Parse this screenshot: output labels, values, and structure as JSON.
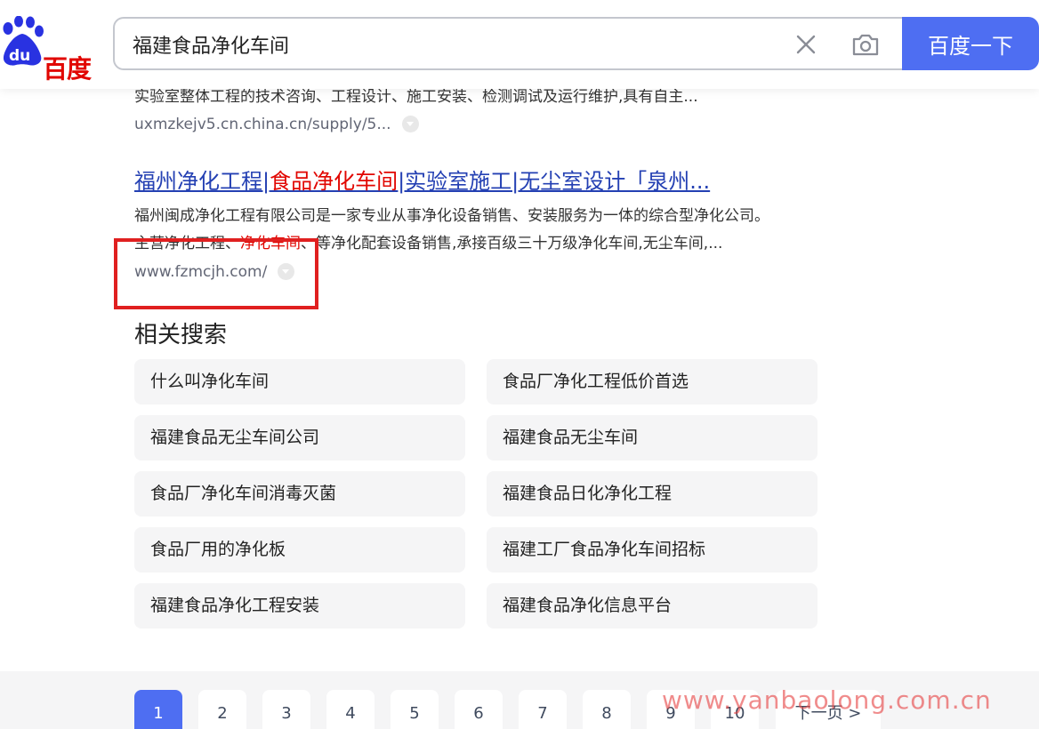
{
  "header": {
    "logo_text": "百度",
    "search_value": "福建食品净化车间",
    "search_button_label": "百度一下"
  },
  "prev_result": {
    "desc_partial": "实验室整体工程的技术咨询、工程设计、施工安装、检测调试及运行维护,具有自主...",
    "url": "uxmzkejv5.cn.china.cn/supply/5..."
  },
  "result": {
    "title_part1": "福州净化工程|",
    "title_highlight": "食品净化车间",
    "title_part2": "|实验室施工|无尘室设计「泉州...",
    "desc_line1": "福州闽成净化工程有限公司是一家专业从事净化设备销售、安装服务为一体的综合型净化公司。",
    "desc_line2_pre": "主营净化工程、",
    "desc_line2_hl": "净化车间",
    "desc_line2_post": "、等净化配套设备销售,承接百级三十万级净化车间,无尘车间,...",
    "url": "www.fzmcjh.com/"
  },
  "related": {
    "title": "相关搜索",
    "items": [
      "什么叫净化车间",
      "食品厂净化工程低价首选",
      "福建食品无尘车间公司",
      "福建食品无尘车间",
      "食品厂净化车间消毒灭菌",
      "福建食品日化净化工程",
      "食品厂用的净化板",
      "福建工厂食品净化车间招标",
      "福建食品净化工程安装",
      "福建食品净化信息平台"
    ]
  },
  "pagination": {
    "pages": [
      "1",
      "2",
      "3",
      "4",
      "5",
      "6",
      "7",
      "8",
      "9",
      "10"
    ],
    "active": "1",
    "next_label": "下一页 >"
  },
  "watermark": "www.yanbaolong.com.cn",
  "colors": {
    "brand_blue": "#4e6ef2",
    "link_blue": "#2440b3",
    "highlight_red": "#e10601",
    "annotation_red": "#e02020"
  },
  "icons": {
    "logo": "baidu-paw-icon",
    "clear": "close-icon",
    "camera": "camera-icon",
    "url_menu": "chevron-down-icon"
  }
}
